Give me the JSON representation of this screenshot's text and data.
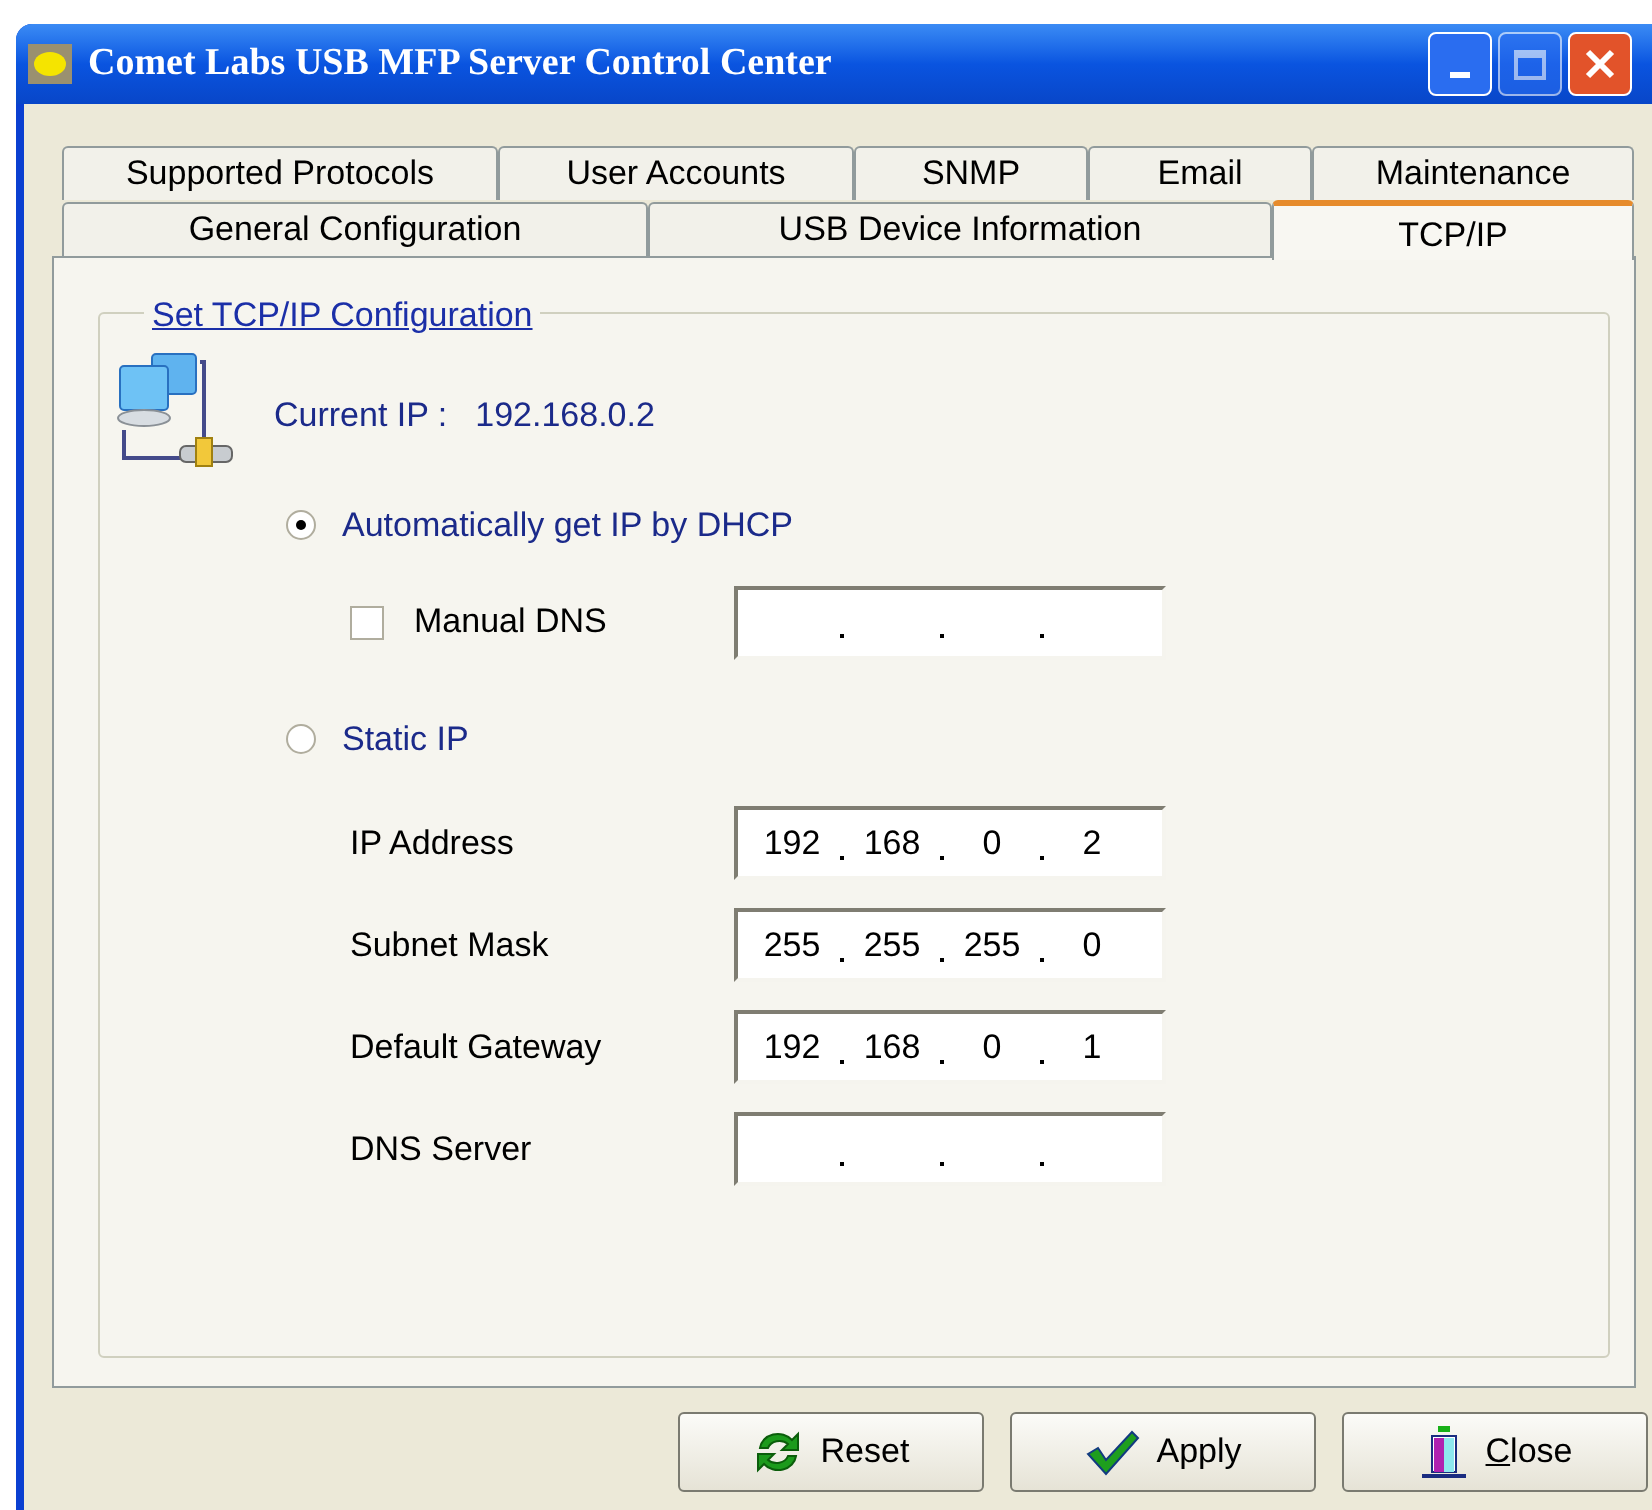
{
  "window": {
    "title": "Comet Labs USB MFP Server Control Center"
  },
  "tab_rows": [
    [
      {
        "label": "Supported Protocols",
        "selected": false
      },
      {
        "label": "User Accounts",
        "selected": false
      },
      {
        "label": "SNMP",
        "selected": false
      },
      {
        "label": "Email",
        "selected": false
      },
      {
        "label": "Maintenance",
        "selected": false
      }
    ],
    [
      {
        "label": "General Configuration",
        "selected": false
      },
      {
        "label": "USB Device Information",
        "selected": false
      },
      {
        "label": "TCP/IP",
        "selected": true
      }
    ]
  ],
  "group": {
    "title": "Set TCP/IP Configuration",
    "current_ip_label": "Current IP :",
    "current_ip": "192.168.0.2",
    "dhcp": {
      "label": "Automatically get IP by DHCP",
      "selected": true
    },
    "manual_dns": {
      "label": "Manual DNS",
      "checked": false
    },
    "static": {
      "label": "Static IP",
      "selected": false
    },
    "fields": [
      {
        "label": "IP Address",
        "octets": [
          "192",
          "168",
          "0",
          "2"
        ]
      },
      {
        "label": "Subnet Mask",
        "octets": [
          "255",
          "255",
          "255",
          "0"
        ]
      },
      {
        "label": "Default Gateway",
        "octets": [
          "192",
          "168",
          "0",
          "1"
        ]
      },
      {
        "label": "DNS Server"
      }
    ]
  },
  "buttons": [
    {
      "label": "Reset",
      "kind": "reset",
      "underline_first": false
    },
    {
      "label": "Apply",
      "kind": "apply",
      "underline_first": false
    },
    {
      "label": "Close",
      "kind": "close",
      "underline_first": true
    }
  ]
}
